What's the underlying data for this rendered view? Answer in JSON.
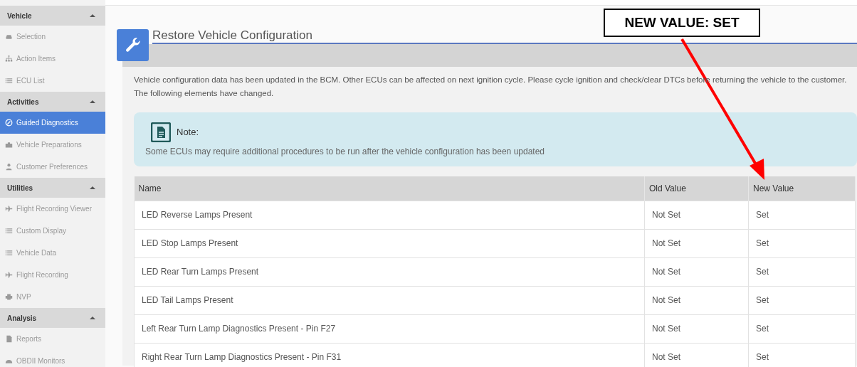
{
  "sidebar": {
    "sections": [
      {
        "title": "Vehicle",
        "expanded": true,
        "items": [
          {
            "label": "Selection",
            "selected": false,
            "disabled": true
          },
          {
            "label": "Action Items",
            "selected": false,
            "disabled": true
          },
          {
            "label": "ECU List",
            "selected": false,
            "disabled": true
          }
        ]
      },
      {
        "title": "Activities",
        "expanded": true,
        "items": [
          {
            "label": "Guided Diagnostics",
            "selected": true,
            "disabled": false
          },
          {
            "label": "Vehicle Preparations",
            "selected": false,
            "disabled": true
          },
          {
            "label": "Customer Preferences",
            "selected": false,
            "disabled": true
          }
        ]
      },
      {
        "title": "Utilities",
        "expanded": true,
        "items": [
          {
            "label": "Flight Recording Viewer",
            "selected": false,
            "disabled": true
          },
          {
            "label": "Custom Display",
            "selected": false,
            "disabled": true
          },
          {
            "label": "Vehicle Data",
            "selected": false,
            "disabled": true
          },
          {
            "label": "Flight Recording",
            "selected": false,
            "disabled": true
          },
          {
            "label": "NVP",
            "selected": false,
            "disabled": true
          }
        ]
      },
      {
        "title": "Analysis",
        "expanded": true,
        "items": [
          {
            "label": "Reports",
            "selected": false,
            "disabled": true
          },
          {
            "label": "OBDII Monitors",
            "selected": false,
            "disabled": true
          }
        ]
      }
    ]
  },
  "panel": {
    "title": "Restore Vehicle Configuration",
    "message": "Vehicle configuration data has been updated in the BCM. Other ECUs can be affected on next ignition cycle. Please cycle ignition and check/clear DTCs before returning the vehicle to the customer. The following elements have changed.",
    "note": {
      "title": "Note:",
      "text": "Some ECUs may require additional procedures to be run after the vehicle configuration has been updated"
    },
    "table": {
      "columns": [
        "Name",
        "Old Value",
        "New Value"
      ],
      "rows": [
        [
          "LED Reverse Lamps Present",
          "Not Set",
          "Set"
        ],
        [
          "LED Stop Lamps Present",
          "Not Set",
          "Set"
        ],
        [
          "LED Rear Turn Lamps Present",
          "Not Set",
          "Set"
        ],
        [
          "LED Tail Lamps Present",
          "Not Set",
          "Set"
        ],
        [
          "Left Rear Turn Lamp Diagnostics Present - Pin F27",
          "Not Set",
          "Set"
        ],
        [
          "Right Rear Turn Lamp Diagnostics Present - Pin F31",
          "Not Set",
          "Set"
        ]
      ]
    }
  },
  "callout": {
    "text": "NEW VALUE: SET"
  }
}
